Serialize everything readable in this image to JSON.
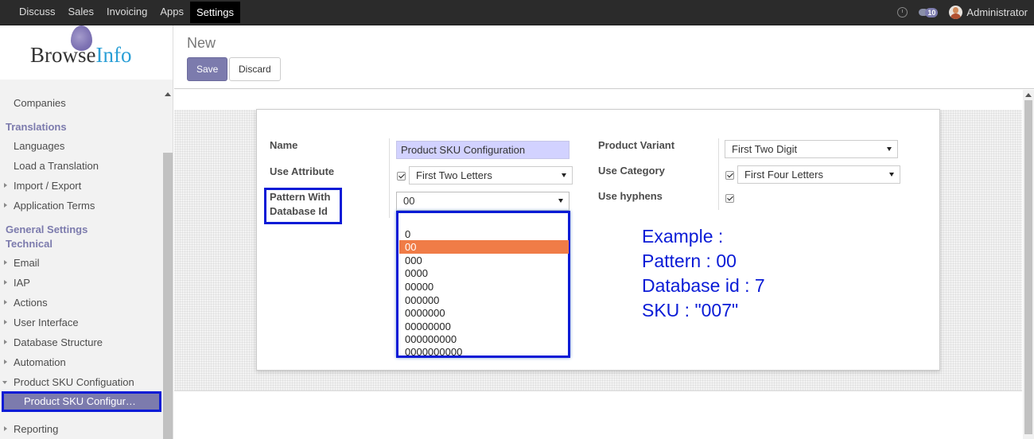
{
  "topbar": {
    "menu": [
      "Discuss",
      "Sales",
      "Invoicing",
      "Apps",
      "Settings"
    ],
    "active": "Settings",
    "chat_count": "10",
    "user": "Administrator"
  },
  "sidebar": {
    "logo_browse": "Browse",
    "logo_info": "Info",
    "items": {
      "companies": "Companies",
      "translations_head": "Translations",
      "languages": "Languages",
      "load_translation": "Load a Translation",
      "import_export": "Import / Export",
      "app_terms": "Application Terms",
      "general_settings_head": "General Settings",
      "technical_head": "Technical",
      "email": "Email",
      "iap": "IAP",
      "actions": "Actions",
      "user_interface": "User Interface",
      "database_structure": "Database Structure",
      "automation": "Automation",
      "product_sku": "Product SKU Configuation",
      "product_sku_active": "Product SKU Configur…",
      "reporting": "Reporting"
    }
  },
  "control_panel": {
    "title": "New",
    "save": "Save",
    "discard": "Discard"
  },
  "form": {
    "name_label": "Name",
    "name_value": "Product SKU Configuration",
    "use_attribute_label": "Use Attribute",
    "use_attribute_value": "First Two Letters",
    "use_attribute_checked": true,
    "pattern_label_1": "Pattern With",
    "pattern_label_2": "Database Id",
    "pattern_value": "00",
    "product_variant_label": "Product Variant",
    "product_variant_value": "First Two Digit",
    "use_category_label": "Use Category",
    "use_category_value": "First Four Letters",
    "use_category_checked": true,
    "use_hyphens_label": "Use hyphens",
    "use_hyphens_checked": true
  },
  "dropdown": {
    "options": [
      "",
      "0",
      "00",
      "000",
      "0000",
      "00000",
      "000000",
      "0000000",
      "00000000",
      "000000000",
      "0000000000"
    ],
    "selected": "00"
  },
  "example": {
    "line1": "Example :",
    "line2": "Pattern : 00",
    "line3": "Database id : 7",
    "line4": "SKU : \"007\""
  },
  "colors": {
    "brand": "#7c7bad",
    "highlight_border": "#0a1bd6",
    "selected_option": "#f07c47",
    "name_field_bg": "#d2d2ff"
  }
}
